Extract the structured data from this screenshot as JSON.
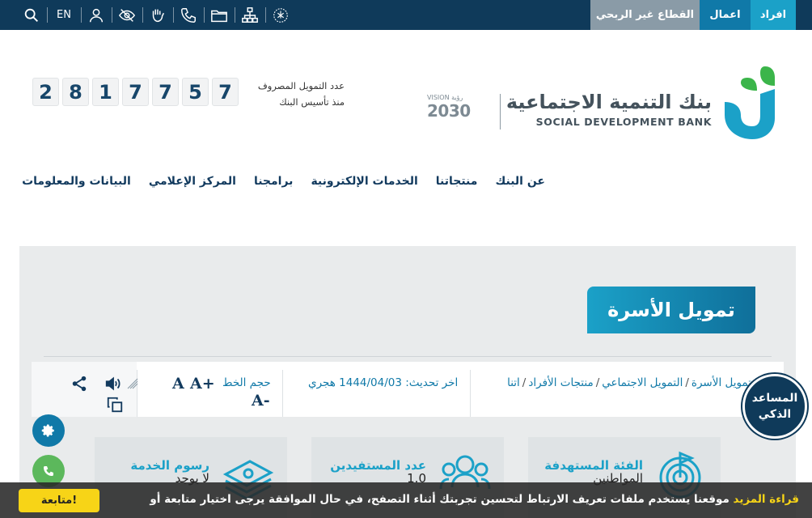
{
  "topbar": {
    "segments": {
      "individuals": "افراد",
      "business": "اعمال",
      "nonprofit": "القطاع غير الربحي"
    },
    "language": "EN"
  },
  "logo": {
    "name_ar": "بنك التنمية الاجتماعية",
    "name_en": "SOCIAL DEVELOPMENT BANK",
    "vision_top": "VISION رؤية",
    "vision_year": "2030",
    "colors": {
      "brand_green": "#3bb54a",
      "brand_teal": "#1ba1c8"
    }
  },
  "counter": {
    "label_1": "عدد التمويل المصروف",
    "label_2": "منذ تأسيس البنك",
    "digits": [
      "7",
      "5",
      "7",
      "7",
      "1",
      "8",
      "2"
    ]
  },
  "nav": [
    "عن البنك",
    "منتجاتنا",
    "الخدمات الإلكترونية",
    "برامجنا",
    "المركز الإعلامي",
    "البيانات والمعلومات"
  ],
  "page": {
    "title": "تمويل الأسرة",
    "breadcrumbs": [
      "اتنا",
      "منتجات الأفراد",
      "التمويل الاجتماعي",
      "تمويل الأسرة"
    ],
    "updated": "اخر تحديث: 1444/04/03 هجري",
    "font_size_label": "حجم الخط",
    "font_plus": "A+",
    "font_normal": "A",
    "font_minus": "A-"
  },
  "cards": [
    {
      "title": "الفئة المستهدفة",
      "value": "المواطنين",
      "icon": "target-icon"
    },
    {
      "title": "عدد المستفيدين",
      "value": "1.0",
      "icon": "people-icon"
    },
    {
      "title": "رسوم الخدمة",
      "value": "لا يوجد",
      "icon": "money-icon"
    }
  ],
  "assistant": {
    "line1": "المساعد",
    "line2": "الذكي"
  },
  "cookie": {
    "text": "موقعنا يستخدم ملفات تعريف الارتباط لتحسين تجربتك أثناء التصفح، في حال الموافقة يرجى اختيار متابعة أو",
    "link": "قراءة المزيد",
    "button": "متابعة!"
  },
  "colors": {
    "topbar": "#0f3a5a",
    "accent": "#1ba1c8",
    "cookie_button": "#f7d417"
  }
}
